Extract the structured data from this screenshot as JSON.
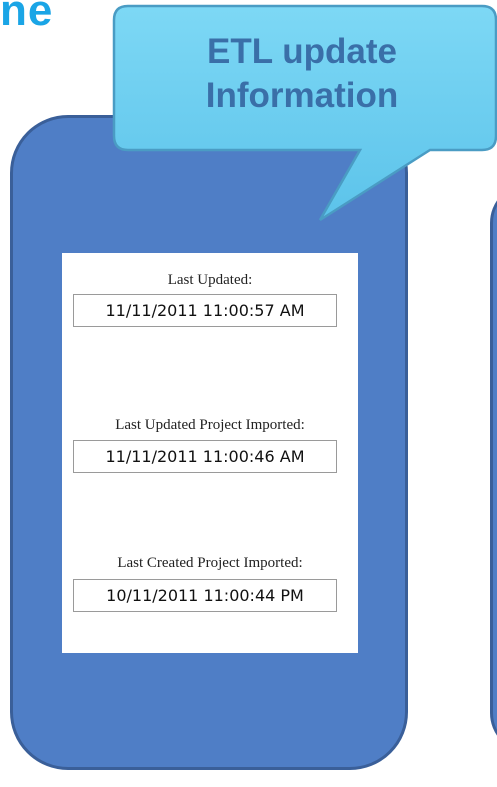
{
  "title_fragment": "ne",
  "callout": {
    "line1": "ETL update",
    "line2": "Information"
  },
  "fields": [
    {
      "label": "Last Updated:",
      "value": "11/11/2011 11:00:57 AM"
    },
    {
      "label": "Last Updated Project Imported:",
      "value": "11/11/2011 11:00:46 AM"
    },
    {
      "label": "Last Created Project Imported:",
      "value": "10/11/2011 11:00:44 PM"
    }
  ],
  "colors": {
    "panel": "#4f7ec6",
    "panel_border": "#3a5f99",
    "callout_fill": "#6fd0f0",
    "callout_text": "#3a6fa8",
    "title_fragment": "#1aa5e6"
  }
}
